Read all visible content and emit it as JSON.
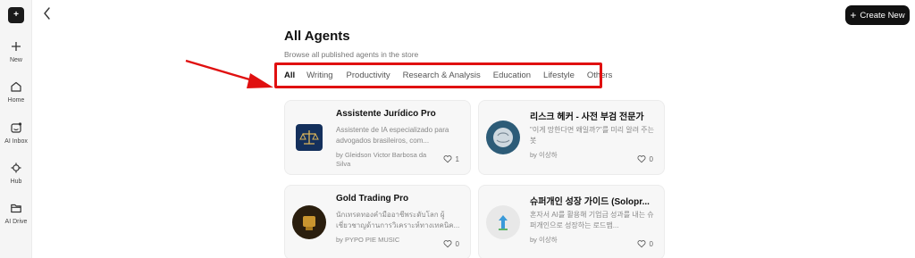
{
  "sidebar": {
    "logo_glyph": "+",
    "items": [
      {
        "label": "New",
        "icon": "plus-icon"
      },
      {
        "label": "Home",
        "icon": "home-icon"
      },
      {
        "label": "AI Inbox",
        "icon": "inbox-icon"
      },
      {
        "label": "Hub",
        "icon": "hub-icon"
      },
      {
        "label": "AI Drive",
        "icon": "folder-icon"
      }
    ]
  },
  "header": {
    "create_label": "Create New",
    "create_plus": "+"
  },
  "main": {
    "title": "All Agents",
    "subtitle": "Browse all published agents in the store",
    "tabs": [
      {
        "label": "All",
        "active": true
      },
      {
        "label": "Writing"
      },
      {
        "label": "Productivity"
      },
      {
        "label": "Research & Analysis"
      },
      {
        "label": "Education"
      },
      {
        "label": "Lifestyle"
      },
      {
        "label": "Others"
      }
    ]
  },
  "cards": [
    {
      "title": "Assistente Jurídico Pro",
      "description": "Assistente de IA especializado para advogados brasileiros, com...",
      "author": "by Gleidson Victor Barbosa da Silva",
      "likes": "1"
    },
    {
      "title": "리스크 헤커 - 사전 부검 전문가",
      "description": "\"이게 망한다면 왜일까?\"를 미리 알려 주는 봇",
      "author": "by 이상하",
      "likes": "0"
    },
    {
      "title": "Gold Trading Pro",
      "description": "นักเทรดทองคำมืออาชีพระดับโลก ผู้เชี่ยวชาญด้านการวิเคราะห์ทางเทคนิค...",
      "author": "by PYPO PIE MUSIC",
      "likes": "0"
    },
    {
      "title": "슈퍼개인 성장 가이드 (Solopr...",
      "description": "혼자서 AI를 활용해 기업급 성과를 내는 슈퍼개인으로 성장하는 로드맵...",
      "author": "by 이상하",
      "likes": "0"
    }
  ],
  "colors": {
    "highlight": "#e01010",
    "accent": "#111111"
  }
}
